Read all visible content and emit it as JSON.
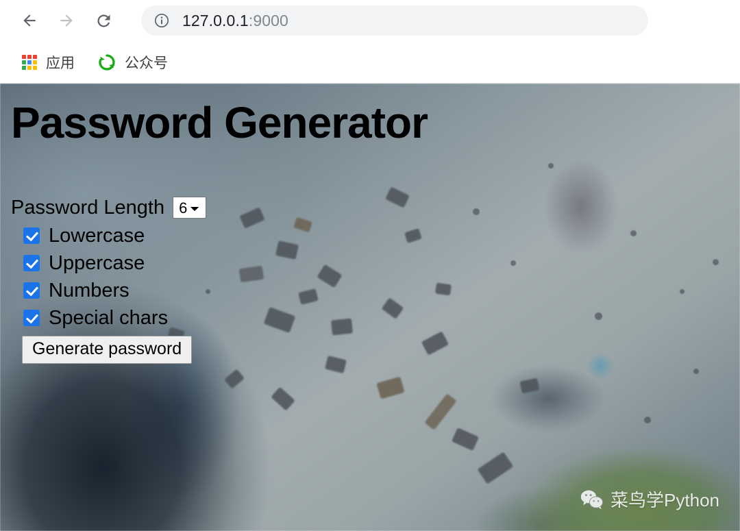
{
  "browser": {
    "back_icon": "arrow-left-icon",
    "forward_icon": "arrow-right-icon",
    "reload_icon": "reload-icon",
    "omnibox": {
      "site_info_icon": "info-circle-icon",
      "url_host": "127.0.0.1",
      "url_port": ":9000",
      "full_url": "127.0.0.1:9000"
    },
    "bookmarks": [
      {
        "icon": "apps-grid-icon",
        "label": "应用"
      },
      {
        "icon": "wechat-official-account-icon",
        "label": "公众号"
      }
    ]
  },
  "page": {
    "title": "Password Generator",
    "length_label": "Password Length",
    "length_value": "6",
    "length_options": [
      "6"
    ],
    "options": [
      {
        "label": "Lowercase",
        "checked": true
      },
      {
        "label": "Uppercase",
        "checked": true
      },
      {
        "label": "Numbers",
        "checked": true
      },
      {
        "label": "Special chars",
        "checked": true
      }
    ],
    "generate_label": "Generate password"
  },
  "watermark": {
    "icon": "wechat-logo-icon",
    "text": "菜鸟学Python"
  },
  "colors": {
    "checkbox_accent": "#1a73e8",
    "omnibox_background": "#f1f3f4",
    "url_host_text": "#202124",
    "url_port_text": "#80868b",
    "apps_icon_red": "#ea4335",
    "apps_icon_green": "#34a853",
    "apps_icon_blue": "#4285f4",
    "apps_icon_yellow": "#fbbc04",
    "wechat_green": "#1aad19",
    "page_title_text": "#000000"
  }
}
